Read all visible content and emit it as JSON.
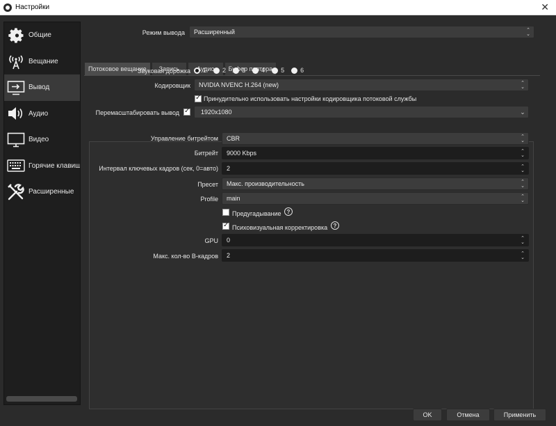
{
  "window": {
    "title": "Настройки"
  },
  "sidebar": {
    "items": [
      {
        "label": "Общие",
        "icon": "gear-icon"
      },
      {
        "label": "Вещание",
        "icon": "broadcast-icon"
      },
      {
        "label": "Вывод",
        "icon": "output-icon",
        "active": true
      },
      {
        "label": "Аудио",
        "icon": "speaker-icon"
      },
      {
        "label": "Видео",
        "icon": "monitor-icon"
      },
      {
        "label": "Горячие клавиши",
        "icon": "keyboard-icon"
      },
      {
        "label": "Расширенные",
        "icon": "tools-icon"
      }
    ]
  },
  "output_mode": {
    "label": "Режим вывода",
    "value": "Расширенный"
  },
  "tabs": [
    "Потоковое вещание",
    "Запись",
    "Аудио",
    "Буфер повтора"
  ],
  "audio_track": {
    "label": "Звуковая дорожка",
    "options": [
      "1",
      "2",
      "3",
      "4",
      "5",
      "6"
    ],
    "selected": "1"
  },
  "encoder": {
    "label": "Кодировщик",
    "value": "NVIDIA NVENC H.264 (new)"
  },
  "enforce": {
    "label": "Принудительно использовать настройки кодировщика потоковой службы",
    "checked": true
  },
  "rescale": {
    "label": "Перемасштабировать вывод",
    "checked": true,
    "value": "1920x1080"
  },
  "settings": {
    "rate_control": {
      "label": "Управление битрейтом",
      "value": "CBR"
    },
    "bitrate": {
      "label": "Битрейт",
      "value": "9000 Kbps"
    },
    "keyframe": {
      "label": "Интервал ключевых кадров (сек, 0=авто)",
      "value": "2"
    },
    "preset": {
      "label": "Пресет",
      "value": "Макс. производительность"
    },
    "profile": {
      "label": "Profile",
      "value": "main"
    },
    "lookahead": {
      "label": "Предугадывание",
      "checked": false
    },
    "psycho": {
      "label": "Психовизуальная корректировка",
      "checked": true
    },
    "gpu": {
      "label": "GPU",
      "value": "0"
    },
    "bframes": {
      "label": "Макс. кол-во B-кадров",
      "value": "2"
    }
  },
  "buttons": {
    "ok": "OK",
    "cancel": "Отмена",
    "apply": "Применить"
  }
}
